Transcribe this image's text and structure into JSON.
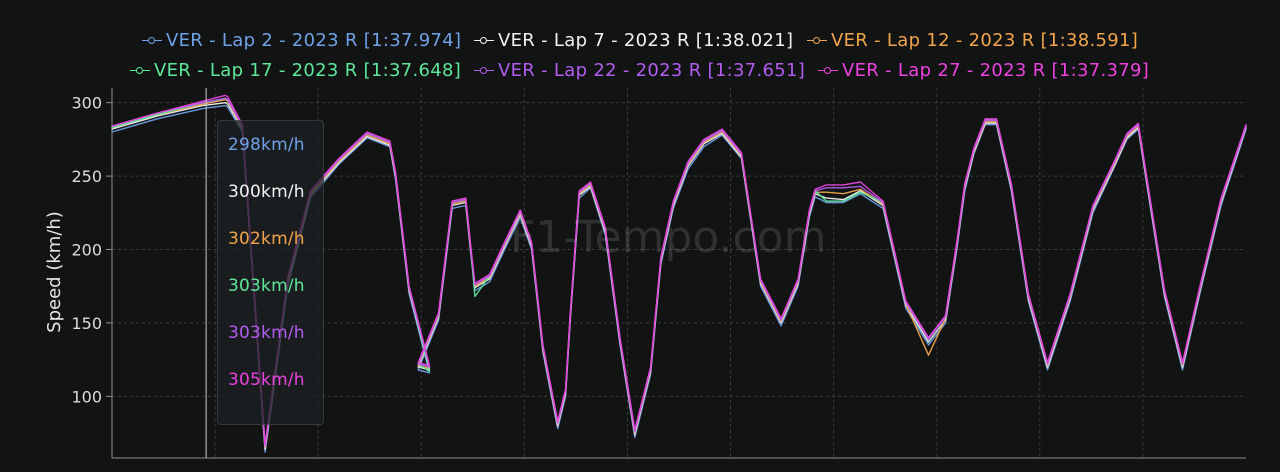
{
  "watermark": "F1-Tempo.com",
  "chart_data": {
    "type": "line",
    "ylabel": "Speed (km/h)",
    "xlabel": "",
    "ylim": [
      58,
      310
    ],
    "xlim": [
      0,
      1
    ],
    "yticks": [
      100,
      150,
      200,
      250,
      300
    ],
    "ytick_labels": [
      "100",
      "150",
      "200",
      "250",
      "300"
    ],
    "grid": true,
    "legend_position": "top",
    "x": [
      0,
      0.04,
      0.08,
      0.1,
      0.102,
      0.115,
      0.135,
      0.155,
      0.175,
      0.2,
      0.225,
      0.245,
      0.25,
      0.262,
      0.28,
      0.27,
      0.288,
      0.3,
      0.312,
      0.316,
      0.32,
      0.333,
      0.345,
      0.36,
      0.37,
      0.38,
      0.393,
      0.4,
      0.404,
      0.412,
      0.422,
      0.435,
      0.448,
      0.461,
      0.475,
      0.484,
      0.495,
      0.508,
      0.522,
      0.538,
      0.555,
      0.572,
      0.59,
      0.605,
      0.615,
      0.62,
      0.63,
      0.645,
      0.66,
      0.68,
      0.7,
      0.72,
      0.735,
      0.745,
      0.752,
      0.76,
      0.77,
      0.78,
      0.793,
      0.808,
      0.825,
      0.845,
      0.865,
      0.885,
      0.895,
      0.905,
      0.915,
      0.928,
      0.944,
      0.96,
      0.978,
      1.0
    ],
    "series": [
      {
        "name": "VER - Lap 2 - 2023 R [1:37.974]",
        "color": "#6fa1e6",
        "values": [
          280,
          289,
          296,
          298,
          297,
          280,
          62,
          175,
          235,
          258,
          276,
          270,
          248,
          170,
          116,
          118,
          152,
          228,
          230,
          200,
          172,
          178,
          198,
          222,
          200,
          130,
          78,
          100,
          150,
          235,
          242,
          210,
          135,
          72,
          115,
          190,
          228,
          255,
          270,
          278,
          262,
          175,
          148,
          175,
          222,
          236,
          232,
          232,
          238,
          228,
          160,
          135,
          150,
          200,
          240,
          265,
          285,
          285,
          240,
          165,
          118,
          165,
          225,
          258,
          275,
          282,
          232,
          168,
          118,
          172,
          230,
          282
        ]
      },
      {
        "name": "VER - Lap 7 - 2023 R [1:38.021]",
        "color": "#f2f2f2",
        "values": [
          282,
          291,
          298,
          300,
          299,
          282,
          64,
          178,
          237,
          259,
          277,
          271,
          250,
          172,
          118,
          120,
          154,
          230,
          232,
          202,
          174,
          180,
          200,
          224,
          202,
          132,
          80,
          102,
          152,
          237,
          243,
          212,
          137,
          74,
          117,
          192,
          230,
          257,
          272,
          279,
          263,
          177,
          150,
          177,
          224,
          238,
          235,
          234,
          240,
          230,
          162,
          137,
          152,
          202,
          242,
          266,
          286,
          286,
          242,
          167,
          120,
          167,
          227,
          259,
          276,
          283,
          234,
          170,
          120,
          174,
          232,
          283
        ]
      },
      {
        "name": "VER - Lap 12 - 2023 R [1:38.591]",
        "color": "#f2a54a",
        "values": [
          283,
          292,
          299,
          302,
          301,
          283,
          65,
          179,
          238,
          260,
          278,
          272,
          251,
          173,
          119,
          121,
          155,
          231,
          233,
          203,
          175,
          181,
          201,
          225,
          203,
          133,
          81,
          103,
          153,
          238,
          244,
          213,
          138,
          75,
          118,
          193,
          231,
          258,
          273,
          280,
          264,
          178,
          151,
          178,
          225,
          239,
          239,
          238,
          241,
          231,
          163,
          128,
          153,
          203,
          243,
          267,
          287,
          287,
          243,
          168,
          121,
          168,
          228,
          260,
          277,
          284,
          235,
          171,
          121,
          175,
          233,
          284
        ]
      },
      {
        "name": "VER - Lap 17 - 2023 R [1:37.648]",
        "color": "#5ee89a",
        "values": [
          283,
          292,
          300,
          303,
          302,
          284,
          66,
          180,
          239,
          261,
          279,
          273,
          252,
          174,
          117,
          122,
          156,
          232,
          234,
          204,
          168,
          182,
          202,
          226,
          204,
          134,
          82,
          104,
          154,
          239,
          245,
          214,
          139,
          76,
          119,
          194,
          232,
          259,
          274,
          281,
          265,
          179,
          152,
          179,
          226,
          240,
          233,
          233,
          239,
          232,
          164,
          139,
          154,
          204,
          244,
          268,
          288,
          288,
          244,
          169,
          122,
          169,
          229,
          261,
          278,
          285,
          236,
          172,
          122,
          176,
          234,
          284
        ]
      },
      {
        "name": "VER - Lap 22 - 2023 R [1:37.651]",
        "color": "#b35cf0",
        "values": [
          284,
          293,
          300,
          303,
          302,
          284,
          66,
          180,
          239,
          261,
          279,
          273,
          252,
          174,
          120,
          122,
          156,
          232,
          234,
          204,
          176,
          182,
          202,
          226,
          204,
          134,
          82,
          104,
          154,
          239,
          245,
          214,
          139,
          76,
          119,
          194,
          232,
          259,
          274,
          281,
          265,
          179,
          152,
          179,
          226,
          240,
          242,
          242,
          243,
          232,
          164,
          139,
          154,
          204,
          244,
          268,
          288,
          288,
          244,
          169,
          122,
          169,
          229,
          261,
          278,
          285,
          236,
          172,
          122,
          176,
          234,
          284
        ]
      },
      {
        "name": "VER - Lap 27 - 2023 R [1:37.379]",
        "color": "#ec43e0",
        "values": [
          284,
          293,
          301,
          305,
          304,
          285,
          67,
          181,
          240,
          262,
          280,
          274,
          253,
          175,
          121,
          123,
          157,
          233,
          235,
          205,
          177,
          183,
          203,
          227,
          205,
          135,
          83,
          105,
          155,
          240,
          246,
          215,
          140,
          77,
          120,
          195,
          233,
          260,
          275,
          282,
          266,
          180,
          153,
          180,
          227,
          241,
          244,
          244,
          246,
          233,
          165,
          140,
          155,
          205,
          245,
          269,
          289,
          289,
          245,
          170,
          123,
          170,
          230,
          262,
          279,
          286,
          237,
          173,
          123,
          177,
          235,
          285
        ]
      }
    ],
    "cursor_x": 0.083,
    "tooltip_values": [
      "298km/h",
      "300km/h",
      "302km/h",
      "303km/h",
      "303km/h",
      "305km/h"
    ]
  }
}
